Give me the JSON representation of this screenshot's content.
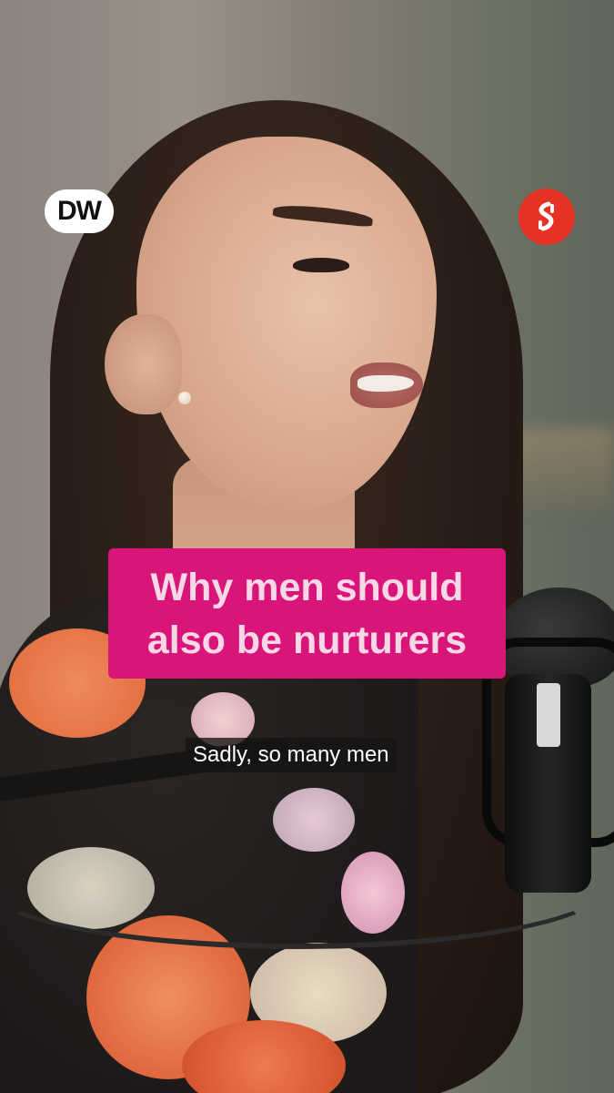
{
  "video": {
    "logos": {
      "left_logo_text": "DW",
      "right_logo_icon": "indian-express-logo",
      "right_logo_color": "#e53224"
    },
    "title": {
      "line1": "Why men should",
      "line2": "also be nurturers",
      "background_color": "#d9157a",
      "text_color": "#f8d8e6"
    },
    "caption": {
      "text": "Sadly, so many men"
    }
  }
}
